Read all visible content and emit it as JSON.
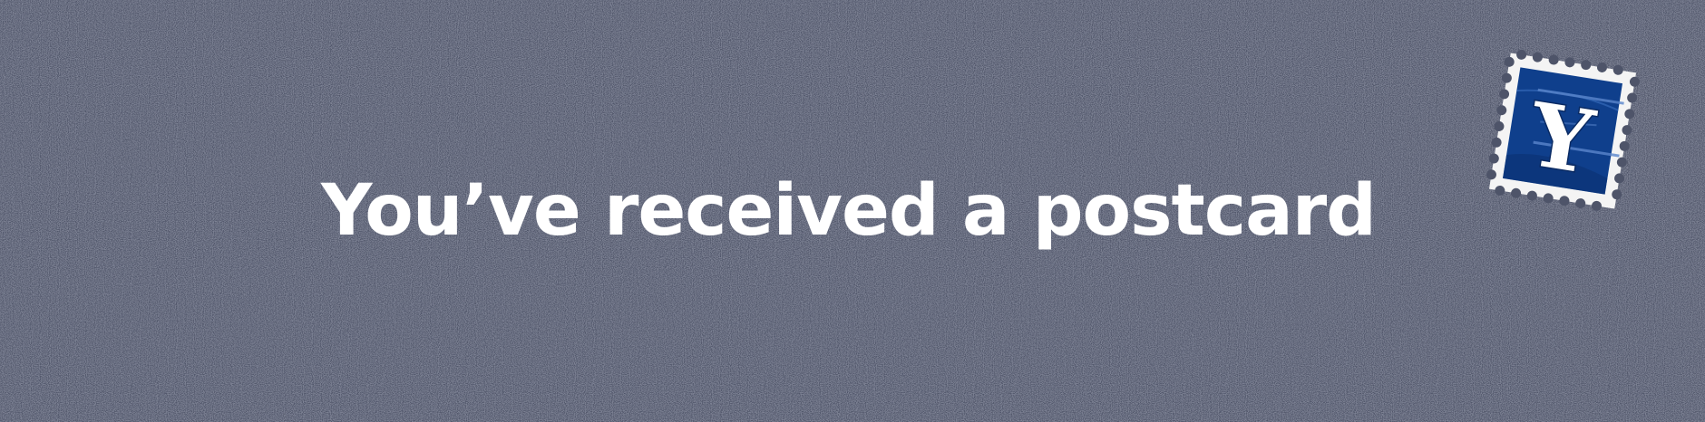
{
  "banner": {
    "headline": "You’ve received a postcard",
    "background_color": "#4e5469",
    "text_color": "#ffffff"
  },
  "stamp": {
    "icon": "postage-stamp-icon",
    "letter": "Y",
    "paper_color": "#f4f4f4",
    "field_color": "#0f3f8c"
  }
}
